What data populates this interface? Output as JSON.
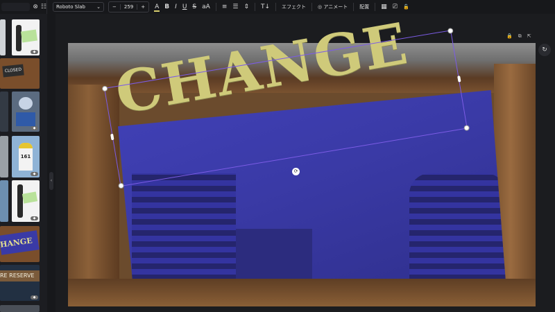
{
  "toolbar": {
    "font_family": "Roboto Slab",
    "font_dropdown_arrow": "⌄",
    "size_minus": "−",
    "font_size": "259",
    "size_plus": "+",
    "text_color_glyph": "A",
    "bold": "B",
    "italic": "I",
    "underline": "U",
    "strike": "S",
    "case": "aA",
    "align_glyph": "≡",
    "list_glyph": "☰",
    "spacing_glyph": "⇕",
    "vertical_glyph": "T↓",
    "effects": "エフェクト",
    "animate": "アニメート",
    "position": "配置",
    "transparency_glyph": "▦",
    "paint_glyph": "⎚",
    "lock_glyph": "🔓",
    "text_color": "#d9cf6f"
  },
  "canvas": {
    "headline": "CHANGE",
    "headline_color": "#cfca7a",
    "selection_color": "#7c5ce6"
  },
  "sidebar": {
    "thumbs": [
      {
        "caption": "",
        "icon": "businesswoman-sign"
      },
      {
        "caption": "CLOSED",
        "icon": "closed-sign"
      },
      {
        "caption": "",
        "icon": "badge-sign"
      },
      {
        "caption": "161",
        "icon": "milestone-sign"
      },
      {
        "caption": "",
        "icon": "woman-sign"
      },
      {
        "caption": "HANGE",
        "icon": "change-sign"
      },
      {
        "caption": "RE RESERVE",
        "icon": "reserve-sign"
      }
    ]
  },
  "page_actions": {
    "lock": "🔒",
    "copy": "⧉",
    "export": "⇱",
    "refresh": "↻"
  }
}
